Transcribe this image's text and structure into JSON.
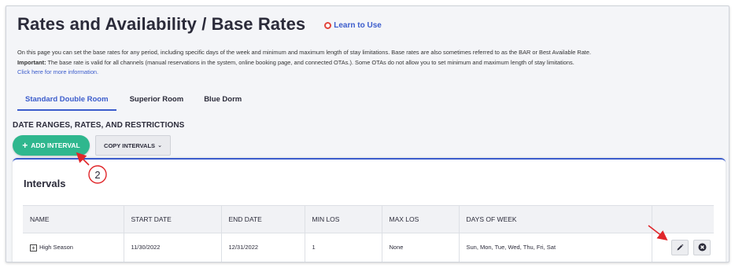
{
  "page": {
    "title": "Rates and Availability / Base Rates",
    "learn_link": "Learn to Use"
  },
  "description": {
    "line1": "On this page you can set the base rates for any period, including specific days of the week and minimum and maximum length of stay limitations. Base rates are also sometimes referred to as the BAR or Best Available Rate.",
    "important_label": "Important:",
    "line2": " The base rate is valid for all channels (manual reservations in the system, online booking page, and connected OTAs.). Some OTAs do not allow you to set minimum and maximum length of stay limitations.",
    "more_link": "Click here for more information."
  },
  "tabs": [
    {
      "label": "Standard Double Room",
      "active": true
    },
    {
      "label": "Superior Room",
      "active": false
    },
    {
      "label": "Blue Dorm",
      "active": false
    }
  ],
  "section": {
    "title": "DATE RANGES, RATES, AND RESTRICTIONS",
    "add_interval": "ADD INTERVAL",
    "copy_intervals": "COPY INTERVALS"
  },
  "intervals": {
    "title": "Intervals",
    "columns": [
      "NAME",
      "START DATE",
      "END DATE",
      "MIN LOS",
      "MAX LOS",
      "DAYS OF WEEK"
    ],
    "rows": [
      {
        "name": "High Season",
        "start_date": "11/30/2022",
        "end_date": "12/31/2022",
        "min_los": "1",
        "max_los": "None",
        "days_of_week": "Sun, Mon, Tue, Wed, Thu, Fri, Sat"
      }
    ]
  },
  "annotations": {
    "step_number": "2",
    "color": "#e0262a"
  },
  "colors": {
    "accent": "#3b5ccc",
    "add_button": "#2fb78e",
    "learn_icon": "#e2453c"
  }
}
